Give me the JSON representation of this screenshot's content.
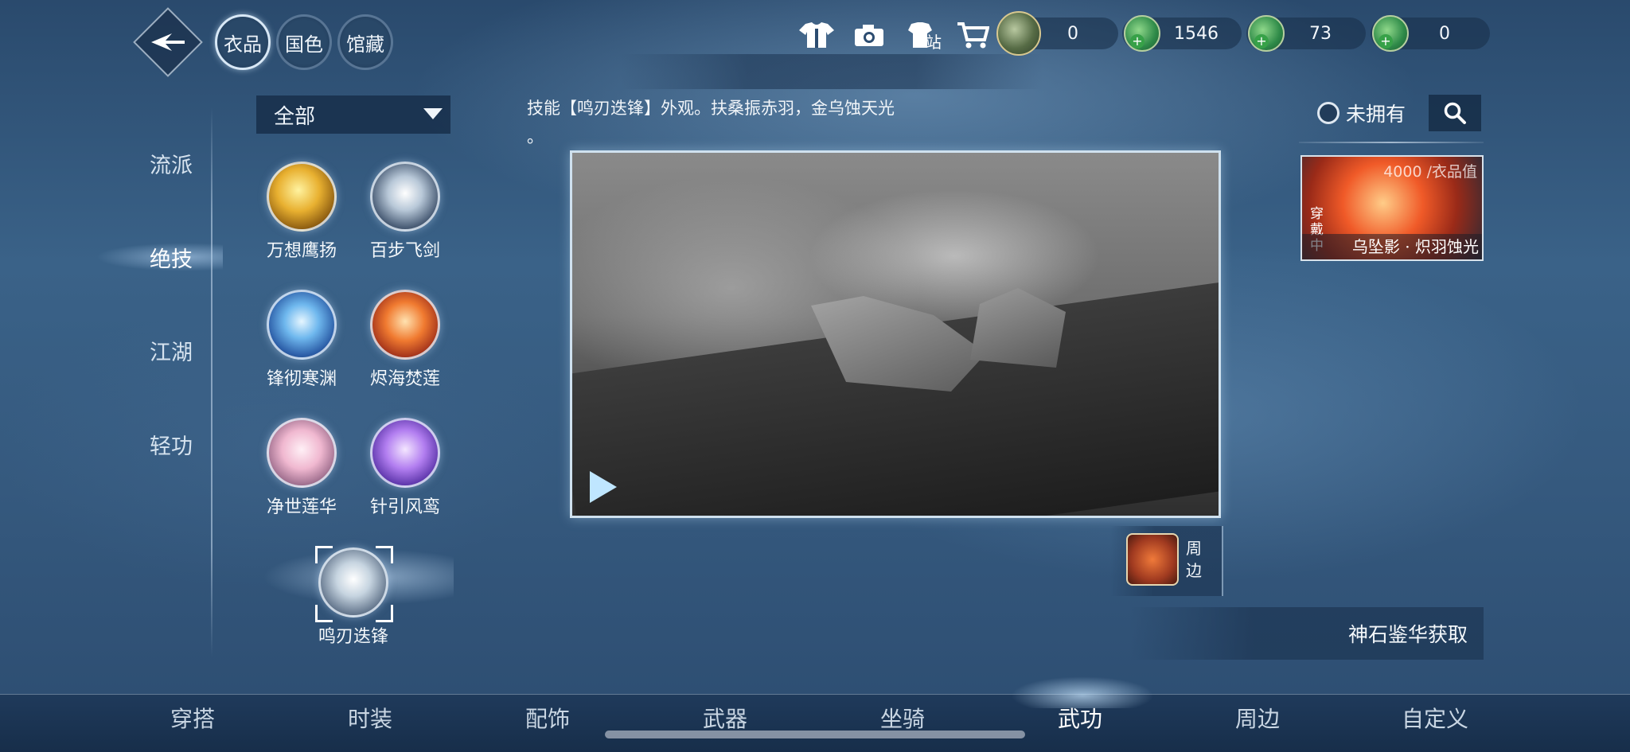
{
  "header": {
    "category_tabs": [
      {
        "label": "衣品",
        "active": true
      },
      {
        "label": "国色",
        "active": false
      },
      {
        "label": "馆藏",
        "active": false
      }
    ],
    "icons": [
      "outfit-icon",
      "camera-icon",
      "outfit-station-icon",
      "shop-cart-icon"
    ],
    "station_icon_text": "站",
    "currencies": [
      {
        "icon": "jade-coin-icon",
        "value": "0"
      },
      {
        "icon": "green-coin-icon",
        "value": "1546"
      },
      {
        "icon": "green-coin-icon",
        "value": "73"
      },
      {
        "icon": "green-coin-icon",
        "value": "0"
      }
    ],
    "plus_symbol": "+"
  },
  "sidebar": {
    "items": [
      {
        "label": "流派",
        "active": false
      },
      {
        "label": "绝技",
        "active": true
      },
      {
        "label": "江湖",
        "active": false
      },
      {
        "label": "轻功",
        "active": false
      }
    ]
  },
  "filter": {
    "selected": "全部"
  },
  "skills": [
    {
      "label": "万想鹰扬",
      "style": "gold"
    },
    {
      "label": "百步飞剑",
      "style": "silver"
    },
    {
      "label": "锋彻寒渊",
      "style": "ice"
    },
    {
      "label": "烬海焚莲",
      "style": "fire"
    },
    {
      "label": "净世莲华",
      "style": "lotus"
    },
    {
      "label": "针引风鸾",
      "style": "violet"
    },
    {
      "label": "鸣刃迭锋",
      "style": "blade",
      "selected": true
    }
  ],
  "description": {
    "line1": "技能【鸣刃迭锋】外观。扶桑振赤羽，金乌蚀天光",
    "line2": "。"
  },
  "merch": {
    "label": "周边"
  },
  "right_panel": {
    "owned_label": "未拥有",
    "card": {
      "value_text": "4000 /衣品值",
      "worn_label": "穿戴中",
      "name": "乌坠影 · 炽羽蚀光"
    },
    "acquire_label": "神石鉴华获取"
  },
  "bottom_tabs": [
    {
      "label": "穿搭",
      "active": false
    },
    {
      "label": "时装",
      "active": false
    },
    {
      "label": "配饰",
      "active": false
    },
    {
      "label": "武器",
      "active": false
    },
    {
      "label": "坐骑",
      "active": false
    },
    {
      "label": "武功",
      "active": true
    },
    {
      "label": "周边",
      "active": false
    },
    {
      "label": "自定义",
      "active": false
    }
  ],
  "colors": {
    "background": "#35597e",
    "panel": "#172e4a",
    "accent_border": "#cfe1ef",
    "text": "#ffffff",
    "currency_green": "#37a148"
  }
}
